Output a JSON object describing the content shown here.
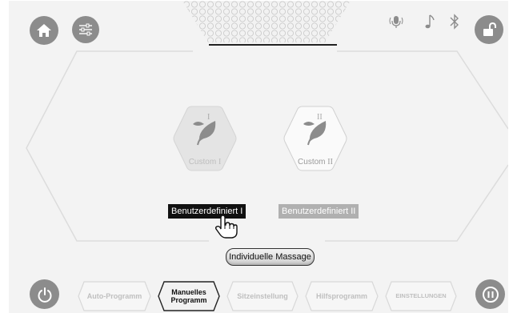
{
  "header": {
    "left_icons": [
      "home-icon",
      "sliders-icon"
    ],
    "right_icons": [
      "voice-icon",
      "music-note-icon",
      "bluetooth-icon",
      "unlock-icon"
    ]
  },
  "programs": [
    {
      "card_label": "Custom",
      "roman": "I",
      "name": "Benutzerdefiniert I",
      "selected": true
    },
    {
      "card_label": "Custom",
      "roman": "II",
      "name": "Benutzerdefiniert II",
      "selected": false
    }
  ],
  "individual_massage_label": "Individuelle Massage",
  "nav": {
    "tabs": [
      {
        "label": "Auto-Programm",
        "active": false
      },
      {
        "label": "Manuelles Programm",
        "active": true
      },
      {
        "label": "Sitzeinstellung",
        "active": false
      },
      {
        "label": "Hilfsprogramm",
        "active": false
      },
      {
        "label": "EINSTELLUNGEN",
        "active": false
      }
    ],
    "left_icon": "power-icon",
    "right_icon": "pause-icon"
  },
  "colors": {
    "background": "#f3f3f3",
    "icon_gray": "#8c8c8c",
    "selected_black": "#111111",
    "inactive_gray": "#b0b0b0"
  }
}
